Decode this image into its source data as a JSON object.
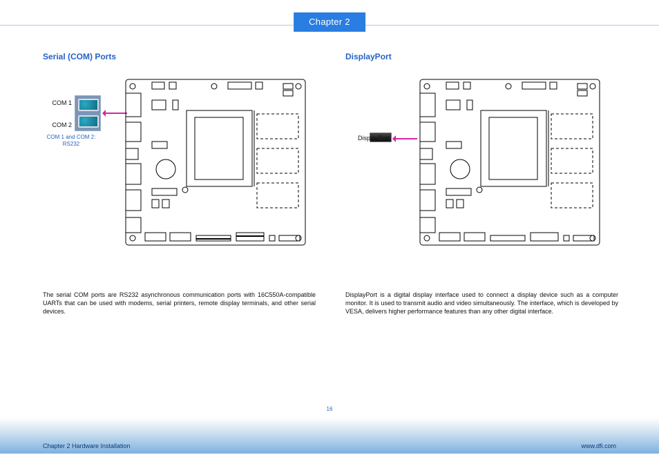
{
  "chapter": {
    "tab": "Chapter 2"
  },
  "left": {
    "heading": "Serial (COM) Ports",
    "labels": {
      "com1": "COM 1",
      "com2": "COM 2",
      "note": "COM 1 and COM 2: RS232"
    },
    "paragraph": "The serial COM ports are RS232 asynchronous communication ports with 16C550A-compatible UARTs that can be used with modems, serial printers, remote display terminals, and other serial devices."
  },
  "right": {
    "heading": "DisplayPort",
    "labels": {
      "dp": "DisplayPort"
    },
    "paragraph": "DisplayPort is a digital display interface used to connect a display device such as a computer monitor. It is used to transmit audio and video simultaneously. The interface, which is developed by VESA, delivers higher performance features than any other digital interface."
  },
  "footer": {
    "page": "16",
    "left": "Chapter 2 Hardware Installation",
    "right": "www.dfi.com"
  }
}
